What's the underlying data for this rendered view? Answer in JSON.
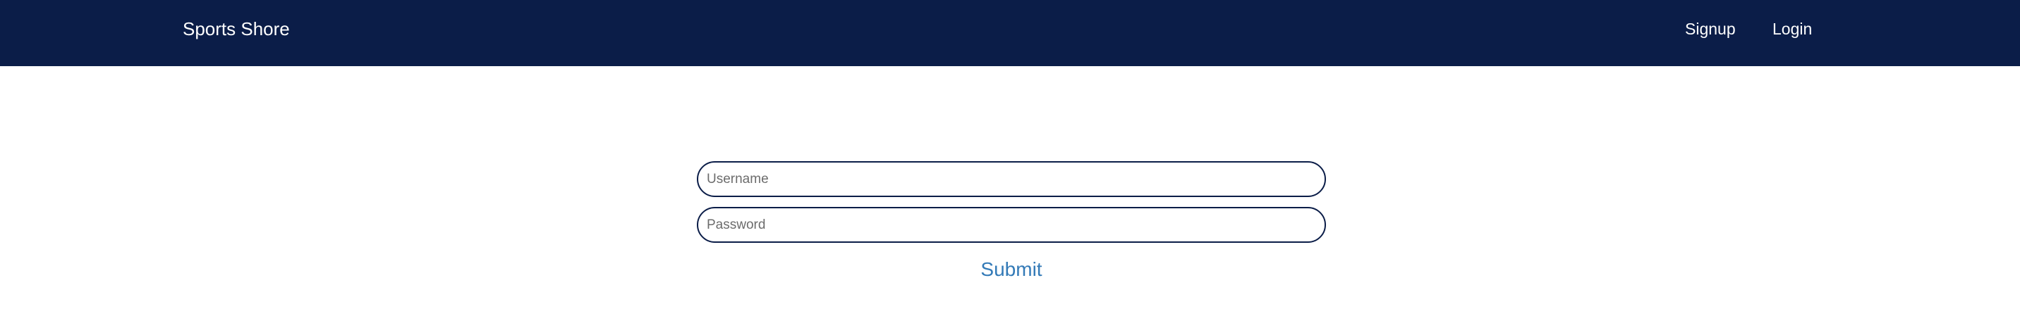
{
  "navbar": {
    "brand": "Sports Shore",
    "links": [
      {
        "label": "Signup"
      },
      {
        "label": "Login"
      }
    ],
    "background_color": "#0b1d48"
  },
  "login_form": {
    "username": {
      "placeholder": "Username",
      "value": ""
    },
    "password": {
      "placeholder": "Password",
      "value": ""
    },
    "submit_label": "Submit",
    "border_color": "#0b1d48",
    "submit_color": "#337ab7"
  }
}
